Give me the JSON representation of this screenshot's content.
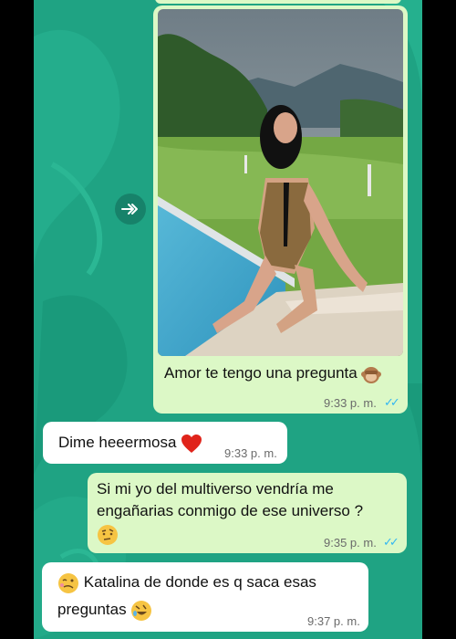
{
  "colors": {
    "chat_background": "#1fa383",
    "outgoing_bubble": "#dcf8c6",
    "incoming_bubble": "#ffffff",
    "read_ticks": "#34b7f1",
    "timestamp": "#6b6b6b"
  },
  "forward_icon": "forward-double-arrow-icon",
  "messages": [
    {
      "direction": "outgoing",
      "has_photo": true,
      "text": "Amor te tengo una pregunta",
      "emoji": "see-no-evil-monkey-icon",
      "time": "9:33 p. m.",
      "status": "read",
      "ticks": "✓✓"
    },
    {
      "direction": "incoming",
      "text": "Dime heeermosa",
      "emoji": "red-heart-icon",
      "time": "9:33 p. m."
    },
    {
      "direction": "outgoing",
      "line1": "Si mi yo del multiverso vendría me",
      "line2": "engañarias conmigo de ese universo ?",
      "emoji": "face-with-raised-eyebrow-icon",
      "time": "9:35 p. m.",
      "status": "read",
      "ticks": "✓✓"
    },
    {
      "direction": "incoming",
      "emoji_leading": "woozy-face-icon",
      "line1": "Katalina de donde es q saca esas",
      "line2": "preguntas",
      "emoji_trailing": "rolling-on-floor-laughing-icon",
      "time": "9:37 p. m."
    }
  ]
}
